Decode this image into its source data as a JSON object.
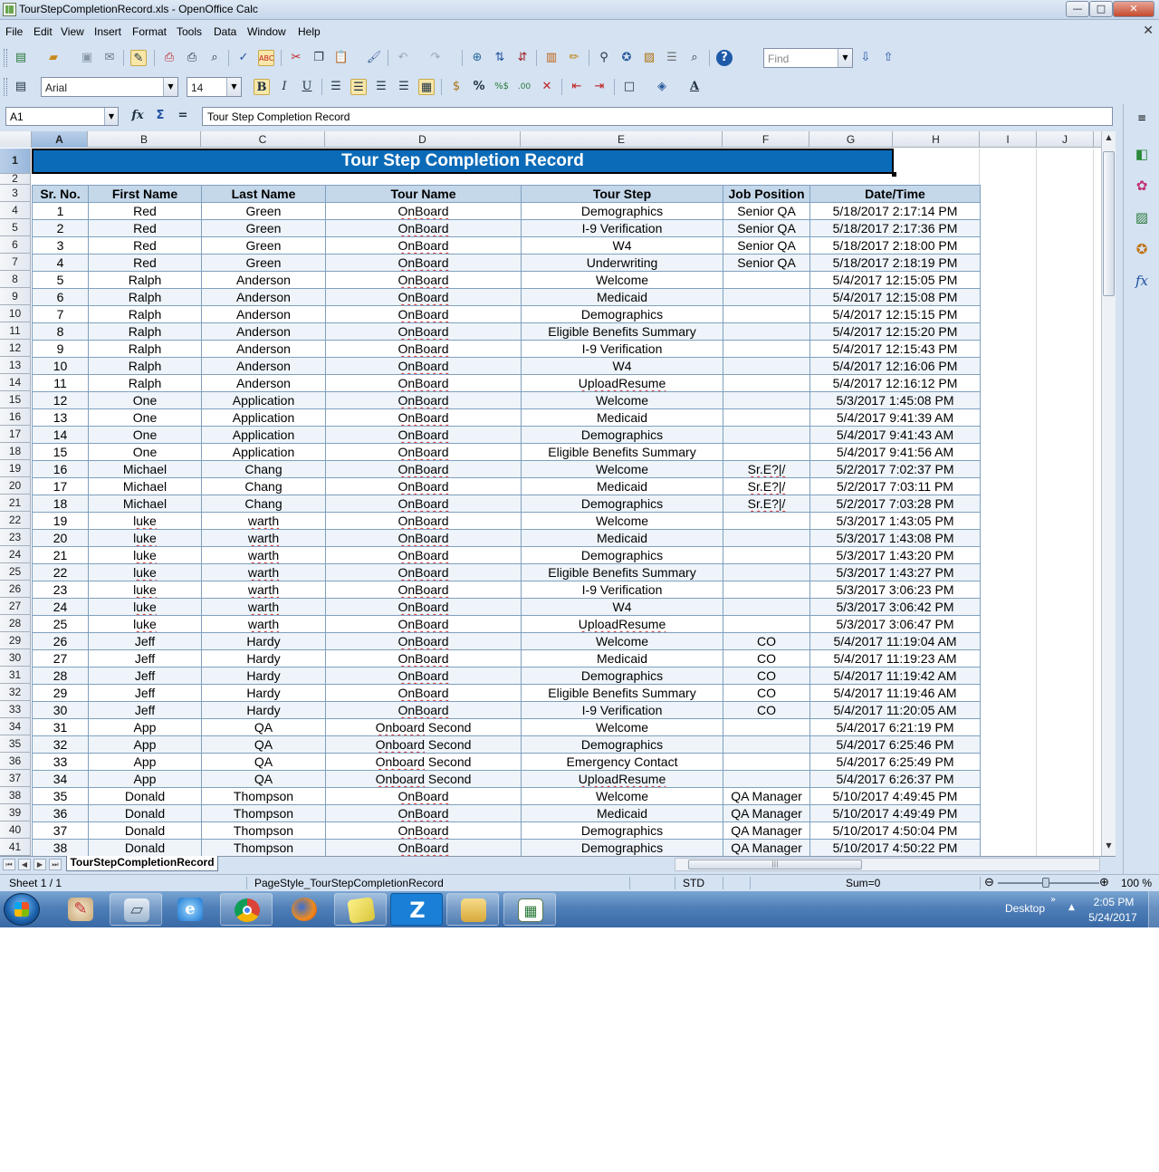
{
  "window": {
    "title": "TourStepCompletionRecord.xls - OpenOffice Calc",
    "minimize_glyph": "—",
    "maximize_glyph": "□",
    "close_glyph": "✕"
  },
  "menu": [
    "File",
    "Edit",
    "View",
    "Insert",
    "Format",
    "Tools",
    "Data",
    "Window",
    "Help"
  ],
  "doc_close_glyph": "✕",
  "toolbar": {
    "find_placeholder": "Find",
    "font_name": "Arial",
    "font_size": "14",
    "bold_glyph": "B",
    "italic_glyph": "I",
    "underline_glyph": "U",
    "percent_glyph": "%"
  },
  "formula_bar": {
    "cell_ref": "A1",
    "content": "Tour Step Completion Record",
    "equal_glyph": "="
  },
  "columns": [
    "A",
    "B",
    "C",
    "D",
    "E",
    "F",
    "G",
    "H",
    "I",
    "J"
  ],
  "selected_column": "A",
  "selected_row": "1",
  "sheet": {
    "title": "Tour Step Completion Record",
    "headers": [
      "Sr. No.",
      "First Name",
      "Last Name",
      "Tour Name",
      "Tour Step",
      "Job Position",
      "Date/Time"
    ],
    "rows": [
      [
        "1",
        "Red",
        "Green",
        "OnBoard",
        "Demographics",
        "Senior QA",
        "5/18/2017 2:17:14 PM"
      ],
      [
        "2",
        "Red",
        "Green",
        "OnBoard",
        "I-9 Verification",
        "Senior QA",
        "5/18/2017 2:17:36 PM"
      ],
      [
        "3",
        "Red",
        "Green",
        "OnBoard",
        "W4",
        "Senior QA",
        "5/18/2017 2:18:00 PM"
      ],
      [
        "4",
        "Red",
        "Green",
        "OnBoard",
        "Underwriting",
        "Senior QA",
        "5/18/2017 2:18:19 PM"
      ],
      [
        "5",
        "Ralph",
        "Anderson",
        "OnBoard",
        "Welcome",
        "",
        "5/4/2017 12:15:05 PM"
      ],
      [
        "6",
        "Ralph",
        "Anderson",
        "OnBoard",
        "Medicaid",
        "",
        "5/4/2017 12:15:08 PM"
      ],
      [
        "7",
        "Ralph",
        "Anderson",
        "OnBoard",
        "Demographics",
        "",
        "5/4/2017 12:15:15 PM"
      ],
      [
        "8",
        "Ralph",
        "Anderson",
        "OnBoard",
        "Eligible Benefits Summary",
        "",
        "5/4/2017 12:15:20 PM"
      ],
      [
        "9",
        "Ralph",
        "Anderson",
        "OnBoard",
        "I-9 Verification",
        "",
        "5/4/2017 12:15:43 PM"
      ],
      [
        "10",
        "Ralph",
        "Anderson",
        "OnBoard",
        "W4",
        "",
        "5/4/2017 12:16:06 PM"
      ],
      [
        "11",
        "Ralph",
        "Anderson",
        "OnBoard",
        "UploadResume",
        "",
        "5/4/2017 12:16:12 PM"
      ],
      [
        "12",
        "One",
        "Application",
        "OnBoard",
        "Welcome",
        "",
        "5/3/2017 1:45:08 PM"
      ],
      [
        "13",
        "One",
        "Application",
        "OnBoard",
        "Medicaid",
        "",
        "5/4/2017 9:41:39 AM"
      ],
      [
        "14",
        "One",
        "Application",
        "OnBoard",
        "Demographics",
        "",
        "5/4/2017 9:41:43 AM"
      ],
      [
        "15",
        "One",
        "Application",
        "OnBoard",
        "Eligible Benefits Summary",
        "",
        "5/4/2017 9:41:56 AM"
      ],
      [
        "16",
        "Michael",
        "Chang",
        "OnBoard",
        "Welcome",
        "Sr.E?|/",
        "5/2/2017 7:02:37 PM"
      ],
      [
        "17",
        "Michael",
        "Chang",
        "OnBoard",
        "Medicaid",
        "Sr.E?|/",
        "5/2/2017 7:03:11 PM"
      ],
      [
        "18",
        "Michael",
        "Chang",
        "OnBoard",
        "Demographics",
        "Sr.E?|/",
        "5/2/2017 7:03:28 PM"
      ],
      [
        "19",
        "luke",
        "warth",
        "OnBoard",
        "Welcome",
        "",
        "5/3/2017 1:43:05 PM"
      ],
      [
        "20",
        "luke",
        "warth",
        "OnBoard",
        "Medicaid",
        "",
        "5/3/2017 1:43:08 PM"
      ],
      [
        "21",
        "luke",
        "warth",
        "OnBoard",
        "Demographics",
        "",
        "5/3/2017 1:43:20 PM"
      ],
      [
        "22",
        "luke",
        "warth",
        "OnBoard",
        "Eligible Benefits Summary",
        "",
        "5/3/2017 1:43:27 PM"
      ],
      [
        "23",
        "luke",
        "warth",
        "OnBoard",
        "I-9 Verification",
        "",
        "5/3/2017 3:06:23 PM"
      ],
      [
        "24",
        "luke",
        "warth",
        "OnBoard",
        "W4",
        "",
        "5/3/2017 3:06:42 PM"
      ],
      [
        "25",
        "luke",
        "warth",
        "OnBoard",
        "UploadResume",
        "",
        "5/3/2017 3:06:47 PM"
      ],
      [
        "26",
        "Jeff",
        "Hardy",
        "OnBoard",
        "Welcome",
        "CO",
        "5/4/2017 11:19:04 AM"
      ],
      [
        "27",
        "Jeff",
        "Hardy",
        "OnBoard",
        "Medicaid",
        "CO",
        "5/4/2017 11:19:23 AM"
      ],
      [
        "28",
        "Jeff",
        "Hardy",
        "OnBoard",
        "Demographics",
        "CO",
        "5/4/2017 11:19:42 AM"
      ],
      [
        "29",
        "Jeff",
        "Hardy",
        "OnBoard",
        "Eligible Benefits Summary",
        "CO",
        "5/4/2017 11:19:46 AM"
      ],
      [
        "30",
        "Jeff",
        "Hardy",
        "OnBoard",
        "I-9 Verification",
        "CO",
        "5/4/2017 11:20:05 AM"
      ],
      [
        "31",
        "App",
        "QA",
        "Onboard Second",
        "Welcome",
        "",
        "5/4/2017 6:21:19 PM"
      ],
      [
        "32",
        "App",
        "QA",
        "Onboard Second",
        "Demographics",
        "",
        "5/4/2017 6:25:46 PM"
      ],
      [
        "33",
        "App",
        "QA",
        "Onboard Second",
        "Emergency Contact",
        "",
        "5/4/2017 6:25:49 PM"
      ],
      [
        "34",
        "App",
        "QA",
        "Onboard Second",
        "UploadResume",
        "",
        "5/4/2017 6:26:37 PM"
      ],
      [
        "35",
        "Donald",
        "Thompson",
        "OnBoard",
        "Welcome",
        "QA Manager",
        "5/10/2017 4:49:45 PM"
      ],
      [
        "36",
        "Donald",
        "Thompson",
        "OnBoard",
        "Medicaid",
        "QA Manager",
        "5/10/2017 4:49:49 PM"
      ],
      [
        "37",
        "Donald",
        "Thompson",
        "OnBoard",
        "Demographics",
        "QA Manager",
        "5/10/2017 4:50:04 PM"
      ],
      [
        "38",
        "Donald",
        "Thompson",
        "OnBoard",
        "Demographics",
        "QA Manager",
        "5/10/2017 4:50:22 PM"
      ]
    ],
    "spellcheck_words": [
      "OnBoard",
      "Onboard",
      "UploadResume",
      "luke",
      "warth",
      "Sr.E?|/"
    ]
  },
  "sheet_tab": "TourStepCompletionRecord",
  "status_bar": {
    "sheet": "Sheet 1 / 1",
    "page_style": "PageStyle_TourStepCompletionRecord",
    "mode": "STD",
    "sum": "Sum=0",
    "zoom": "100 %"
  },
  "zoom_level_percent": 100,
  "taskbar": {
    "desktop": "Desktop",
    "time": "2:05 PM",
    "date": "5/24/2017",
    "apps": [
      "paint-icon",
      "notepad-icon",
      "internet-explorer-icon",
      "chrome-icon",
      "firefox-icon",
      "sticky-notes-icon",
      "z-app-icon",
      "file-explorer-icon",
      "calc-icon"
    ]
  },
  "colors": {
    "title_banner": "#0b6bb8",
    "header_fill": "#c4d8ea",
    "alt_row_fill": "#eef4f9",
    "chrome_bg": "#d4e2f2"
  }
}
